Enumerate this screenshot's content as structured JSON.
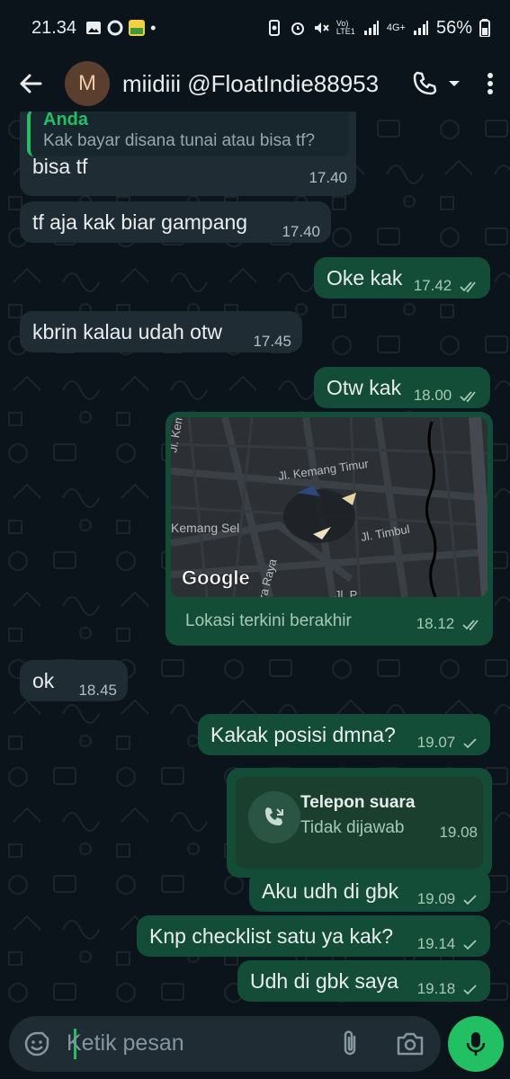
{
  "status_bar": {
    "time": "21.34",
    "battery": "56%",
    "network_top": "4G+",
    "volte": "Vo) LTE1"
  },
  "header": {
    "avatar_letter": "M",
    "contact_name": "miidiii @FloatIndie88953"
  },
  "messages": [
    {
      "dir": "in",
      "quote_author": "Anda",
      "quote_text": "Kak bayar disana tunai atau bisa tf?",
      "text": "bisa tf",
      "time": "17.40"
    },
    {
      "dir": "in",
      "text": "tf aja kak biar gampang",
      "time": "17.40"
    },
    {
      "dir": "out",
      "text": "Oke kak",
      "time": "17.42",
      "ticks": "double"
    },
    {
      "dir": "in",
      "text": "kbrin kalau udah otw",
      "time": "17.45"
    },
    {
      "dir": "out",
      "text": "Otw kak",
      "time": "18.00",
      "ticks": "double"
    },
    {
      "dir": "out",
      "type": "location",
      "map_logo": "Google",
      "map_labels": [
        "Jl. Kemang Timur",
        "Jl. Kem",
        "Kemang Sel",
        "Jl. Timbul",
        "era Raya",
        "Jl. P"
      ],
      "caption": "Lokasi terkini berakhir",
      "time": "18.12",
      "ticks": "double"
    },
    {
      "dir": "in",
      "text": "ok",
      "time": "18.45"
    },
    {
      "dir": "out",
      "text": "Kakak posisi dmna?",
      "time": "19.07",
      "ticks": "single"
    },
    {
      "dir": "out",
      "type": "call",
      "title": "Telepon suara",
      "status": "Tidak dijawab",
      "time": "19.08"
    },
    {
      "dir": "out",
      "text": "Aku udh di gbk",
      "time": "19.09",
      "ticks": "single"
    },
    {
      "dir": "out",
      "text": "Knp checklist satu ya kak?",
      "time": "19.14",
      "ticks": "single"
    },
    {
      "dir": "out",
      "text": "Udh di gbk saya",
      "time": "19.18",
      "ticks": "single"
    }
  ],
  "input": {
    "placeholder": "Ketik pesan"
  },
  "colors": {
    "background": "#0b141a",
    "incoming_bubble": "#1f2c34",
    "outgoing_bubble": "#144d37",
    "accent_green": "#21c063"
  }
}
